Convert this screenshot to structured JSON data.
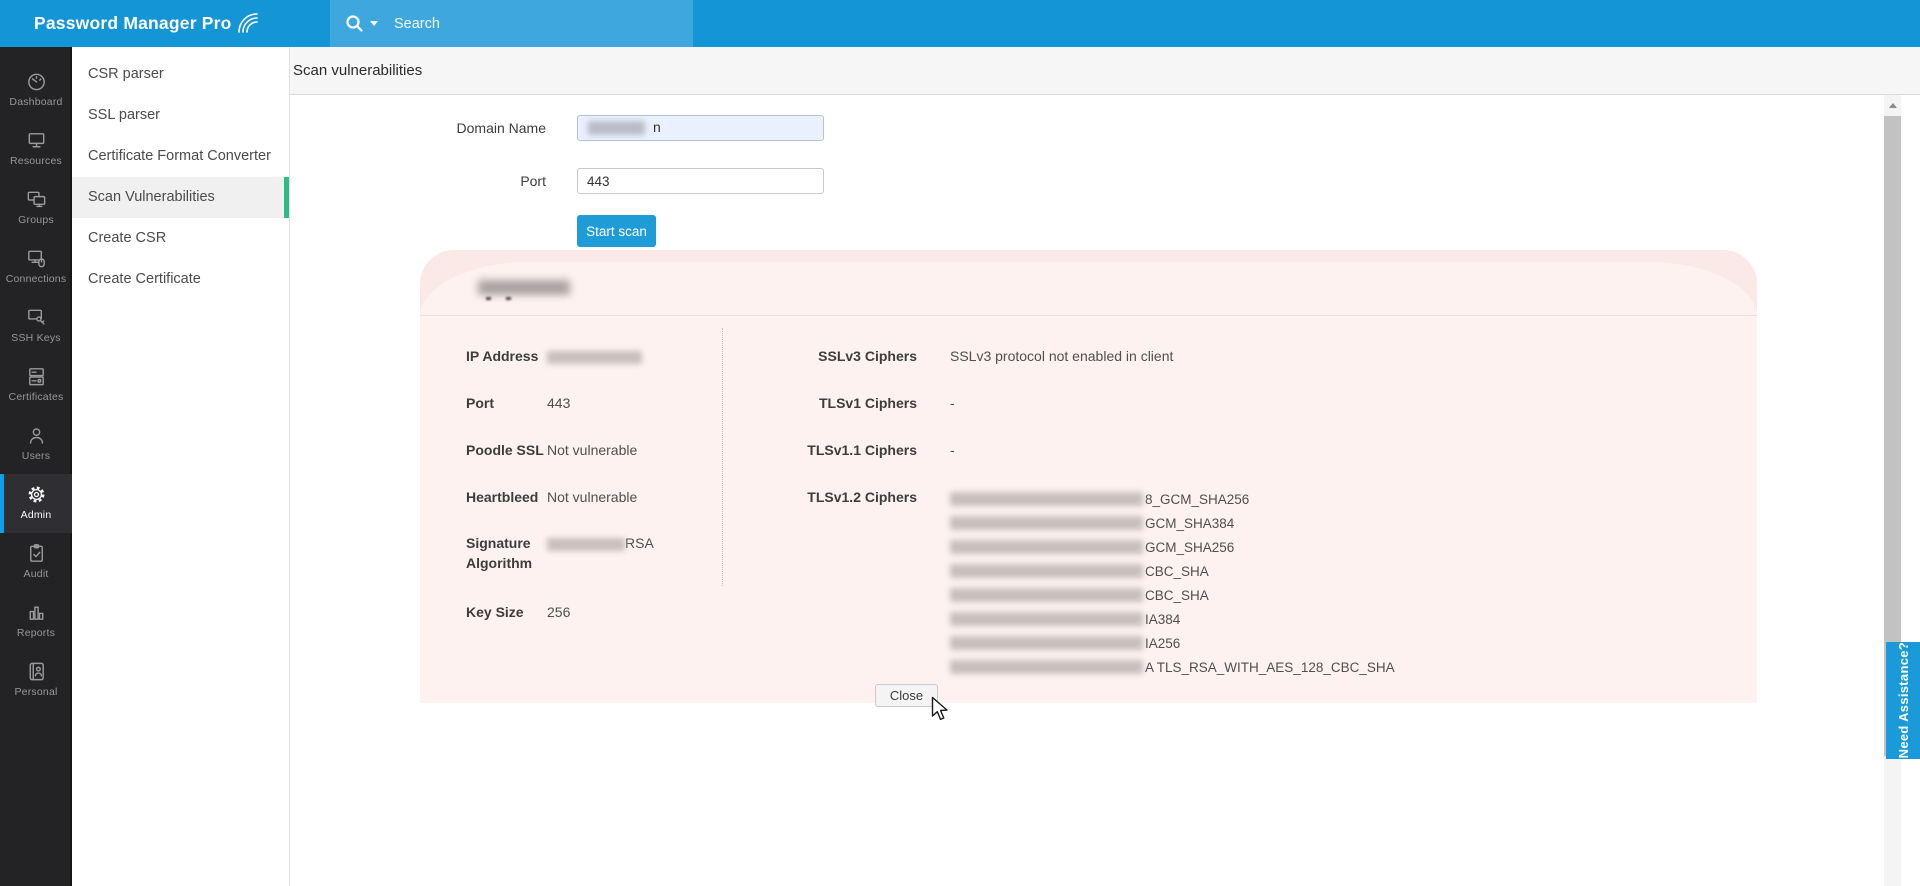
{
  "header": {
    "logo_text": "Password Manager Pro",
    "search_placeholder": "Search",
    "bar_color": "#1495d6",
    "search_band_color": "#3ea8de",
    "icons": [
      "link-dropdown",
      "user-request",
      "notifications-bell",
      "mail-envelope",
      "user-profile"
    ]
  },
  "sidebar": {
    "selected_bar_color": "#09a2ea",
    "items": [
      {
        "label": "Dashboard",
        "selected": false
      },
      {
        "label": "Resources",
        "selected": false
      },
      {
        "label": "Groups",
        "selected": false
      },
      {
        "label": "Connections",
        "selected": false
      },
      {
        "label": "SSH Keys",
        "selected": false
      },
      {
        "label": "Certificates",
        "selected": false
      },
      {
        "label": "Users",
        "selected": false
      },
      {
        "label": "Admin",
        "selected": true
      },
      {
        "label": "Audit",
        "selected": false
      },
      {
        "label": "Reports",
        "selected": false
      },
      {
        "label": "Personal",
        "selected": false
      }
    ]
  },
  "submenu": {
    "selected_index": 3,
    "selected_bar_color": "#2bbd85",
    "items": [
      {
        "label": "CSR parser"
      },
      {
        "label": "SSL parser"
      },
      {
        "label": "Certificate Format Converter"
      },
      {
        "label": "Scan Vulnerabilities"
      },
      {
        "label": "Create CSR"
      },
      {
        "label": "Create Certificate"
      }
    ]
  },
  "page": {
    "title": "Scan vulnerabilities"
  },
  "form": {
    "domain_label": "Domain Name",
    "domain_value_redacted": true,
    "domain_value_visible_char": "n",
    "port_label": "Port",
    "port_value": "443",
    "start_scan_label": "Start scan"
  },
  "results": {
    "header_domain_redacted": true,
    "fields_left": [
      {
        "label": "IP Address",
        "value_redacted": true
      },
      {
        "label": "Port",
        "value": "443"
      },
      {
        "label": "Poodle SSL",
        "value": "Not vulnerable"
      },
      {
        "label": "Heartbleed",
        "value": "Not vulnerable"
      },
      {
        "label": "Signature Algorithm",
        "value_redacted": true,
        "value_visible": "RSA"
      },
      {
        "label": "Key Size",
        "value": "256"
      }
    ],
    "fields_right": [
      {
        "label": "SSLv3 Ciphers",
        "value": "SSLv3 protocol not enabled in client"
      },
      {
        "label": "TLSv1 Ciphers",
        "value": "-"
      },
      {
        "label": "TLSv1.1 Ciphers",
        "value": "-"
      },
      {
        "label": "TLSv1.2 Ciphers"
      }
    ],
    "tls12_cipher_lines": [
      {
        "prefix_redacted": true,
        "visible": "8_GCM_SHA256"
      },
      {
        "prefix_redacted": true,
        "visible": "GCM_SHA384"
      },
      {
        "prefix_redacted": true,
        "visible": "GCM_SHA256"
      },
      {
        "prefix_redacted": true,
        "visible": "CBC_SHA"
      },
      {
        "prefix_redacted": true,
        "visible": "CBC_SHA"
      },
      {
        "prefix_redacted": true,
        "visible": "IA384"
      },
      {
        "prefix_redacted": true,
        "visible": "IA256"
      },
      {
        "prefix_redacted": true,
        "visible": "A TLS_RSA_WITH_AES_128_CBC_SHA"
      }
    ],
    "close_label": "Close"
  },
  "assistance_tab": {
    "label": "Need Assistance?",
    "color": "#1a9ad9"
  }
}
